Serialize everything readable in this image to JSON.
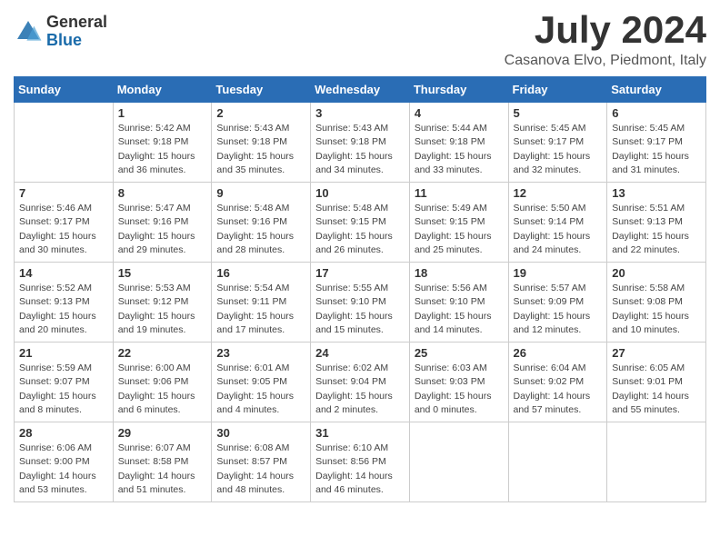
{
  "header": {
    "logo_general": "General",
    "logo_blue": "Blue",
    "month_title": "July 2024",
    "location": "Casanova Elvo, Piedmont, Italy"
  },
  "calendar": {
    "days_of_week": [
      "Sunday",
      "Monday",
      "Tuesday",
      "Wednesday",
      "Thursday",
      "Friday",
      "Saturday"
    ],
    "weeks": [
      [
        {
          "day": "",
          "info": ""
        },
        {
          "day": "1",
          "info": "Sunrise: 5:42 AM\nSunset: 9:18 PM\nDaylight: 15 hours\nand 36 minutes."
        },
        {
          "day": "2",
          "info": "Sunrise: 5:43 AM\nSunset: 9:18 PM\nDaylight: 15 hours\nand 35 minutes."
        },
        {
          "day": "3",
          "info": "Sunrise: 5:43 AM\nSunset: 9:18 PM\nDaylight: 15 hours\nand 34 minutes."
        },
        {
          "day": "4",
          "info": "Sunrise: 5:44 AM\nSunset: 9:18 PM\nDaylight: 15 hours\nand 33 minutes."
        },
        {
          "day": "5",
          "info": "Sunrise: 5:45 AM\nSunset: 9:17 PM\nDaylight: 15 hours\nand 32 minutes."
        },
        {
          "day": "6",
          "info": "Sunrise: 5:45 AM\nSunset: 9:17 PM\nDaylight: 15 hours\nand 31 minutes."
        }
      ],
      [
        {
          "day": "7",
          "info": "Sunrise: 5:46 AM\nSunset: 9:17 PM\nDaylight: 15 hours\nand 30 minutes."
        },
        {
          "day": "8",
          "info": "Sunrise: 5:47 AM\nSunset: 9:16 PM\nDaylight: 15 hours\nand 29 minutes."
        },
        {
          "day": "9",
          "info": "Sunrise: 5:48 AM\nSunset: 9:16 PM\nDaylight: 15 hours\nand 28 minutes."
        },
        {
          "day": "10",
          "info": "Sunrise: 5:48 AM\nSunset: 9:15 PM\nDaylight: 15 hours\nand 26 minutes."
        },
        {
          "day": "11",
          "info": "Sunrise: 5:49 AM\nSunset: 9:15 PM\nDaylight: 15 hours\nand 25 minutes."
        },
        {
          "day": "12",
          "info": "Sunrise: 5:50 AM\nSunset: 9:14 PM\nDaylight: 15 hours\nand 24 minutes."
        },
        {
          "day": "13",
          "info": "Sunrise: 5:51 AM\nSunset: 9:13 PM\nDaylight: 15 hours\nand 22 minutes."
        }
      ],
      [
        {
          "day": "14",
          "info": "Sunrise: 5:52 AM\nSunset: 9:13 PM\nDaylight: 15 hours\nand 20 minutes."
        },
        {
          "day": "15",
          "info": "Sunrise: 5:53 AM\nSunset: 9:12 PM\nDaylight: 15 hours\nand 19 minutes."
        },
        {
          "day": "16",
          "info": "Sunrise: 5:54 AM\nSunset: 9:11 PM\nDaylight: 15 hours\nand 17 minutes."
        },
        {
          "day": "17",
          "info": "Sunrise: 5:55 AM\nSunset: 9:10 PM\nDaylight: 15 hours\nand 15 minutes."
        },
        {
          "day": "18",
          "info": "Sunrise: 5:56 AM\nSunset: 9:10 PM\nDaylight: 15 hours\nand 14 minutes."
        },
        {
          "day": "19",
          "info": "Sunrise: 5:57 AM\nSunset: 9:09 PM\nDaylight: 15 hours\nand 12 minutes."
        },
        {
          "day": "20",
          "info": "Sunrise: 5:58 AM\nSunset: 9:08 PM\nDaylight: 15 hours\nand 10 minutes."
        }
      ],
      [
        {
          "day": "21",
          "info": "Sunrise: 5:59 AM\nSunset: 9:07 PM\nDaylight: 15 hours\nand 8 minutes."
        },
        {
          "day": "22",
          "info": "Sunrise: 6:00 AM\nSunset: 9:06 PM\nDaylight: 15 hours\nand 6 minutes."
        },
        {
          "day": "23",
          "info": "Sunrise: 6:01 AM\nSunset: 9:05 PM\nDaylight: 15 hours\nand 4 minutes."
        },
        {
          "day": "24",
          "info": "Sunrise: 6:02 AM\nSunset: 9:04 PM\nDaylight: 15 hours\nand 2 minutes."
        },
        {
          "day": "25",
          "info": "Sunrise: 6:03 AM\nSunset: 9:03 PM\nDaylight: 15 hours\nand 0 minutes."
        },
        {
          "day": "26",
          "info": "Sunrise: 6:04 AM\nSunset: 9:02 PM\nDaylight: 14 hours\nand 57 minutes."
        },
        {
          "day": "27",
          "info": "Sunrise: 6:05 AM\nSunset: 9:01 PM\nDaylight: 14 hours\nand 55 minutes."
        }
      ],
      [
        {
          "day": "28",
          "info": "Sunrise: 6:06 AM\nSunset: 9:00 PM\nDaylight: 14 hours\nand 53 minutes."
        },
        {
          "day": "29",
          "info": "Sunrise: 6:07 AM\nSunset: 8:58 PM\nDaylight: 14 hours\nand 51 minutes."
        },
        {
          "day": "30",
          "info": "Sunrise: 6:08 AM\nSunset: 8:57 PM\nDaylight: 14 hours\nand 48 minutes."
        },
        {
          "day": "31",
          "info": "Sunrise: 6:10 AM\nSunset: 8:56 PM\nDaylight: 14 hours\nand 46 minutes."
        },
        {
          "day": "",
          "info": ""
        },
        {
          "day": "",
          "info": ""
        },
        {
          "day": "",
          "info": ""
        }
      ]
    ]
  }
}
